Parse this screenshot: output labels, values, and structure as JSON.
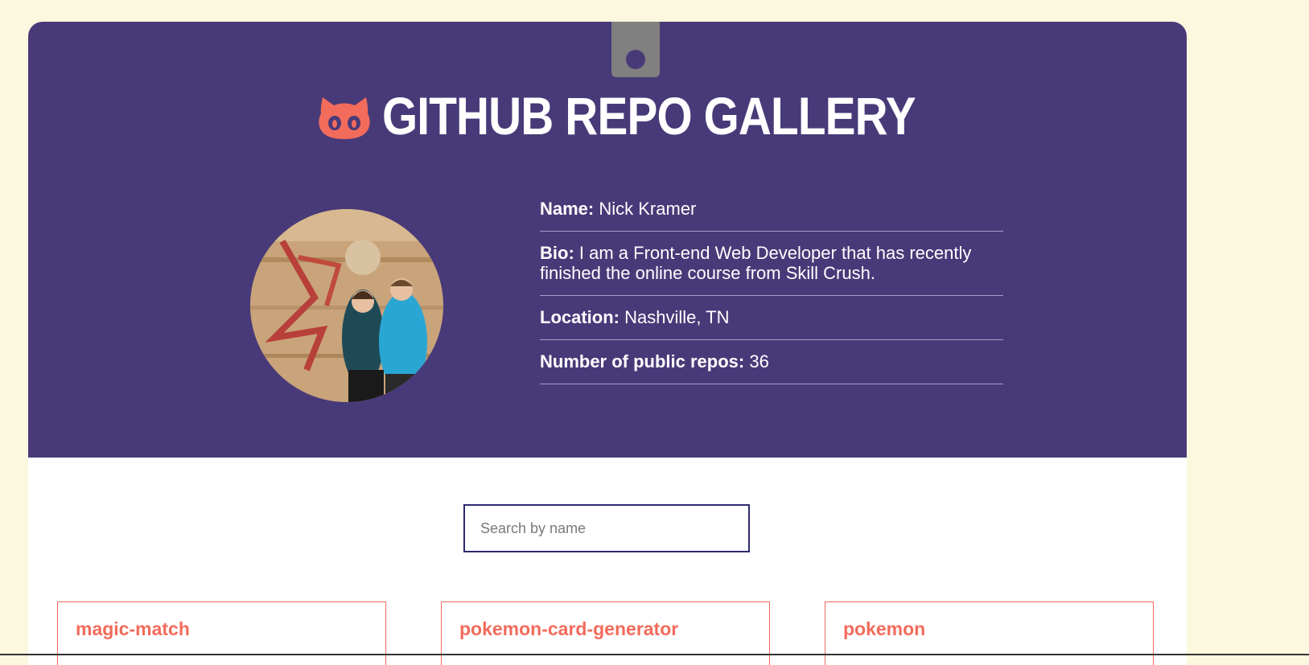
{
  "header": {
    "title": "GITHUB REPO GALLERY",
    "icon": "octocat-icon",
    "accent_color": "#f26b5b",
    "background_color": "#483a78"
  },
  "profile": {
    "avatar_alt": "avatar",
    "rows": [
      {
        "label": "Name:",
        "value": "Nick Kramer"
      },
      {
        "label": "Bio:",
        "value": "I am a Front-end Web Developer that has recently finished the online course from Skill Crush."
      },
      {
        "label": "Location:",
        "value": "Nashville, TN"
      },
      {
        "label": "Number of public repos:",
        "value": "36"
      }
    ]
  },
  "search": {
    "placeholder": "Search by name",
    "value": ""
  },
  "repos": [
    {
      "name": "magic-match"
    },
    {
      "name": "pokemon-card-generator"
    },
    {
      "name": "pokemon"
    }
  ]
}
